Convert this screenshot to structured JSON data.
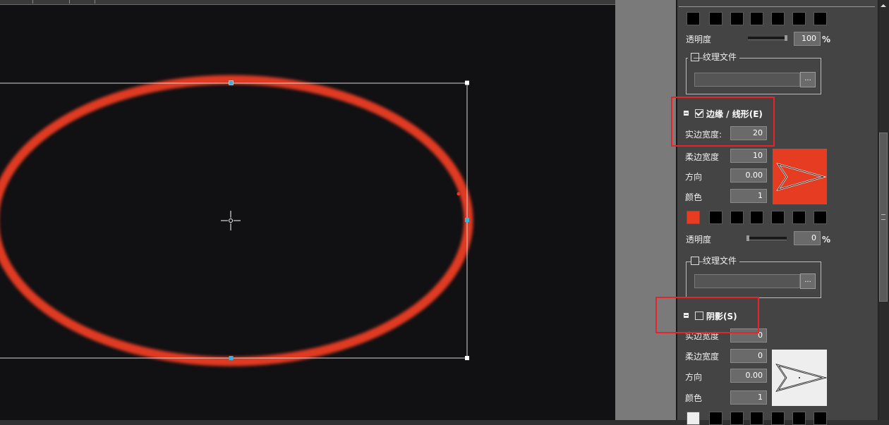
{
  "panel": {
    "opacity_label_1": "透明度",
    "opacity_value_1": "100",
    "opacity_unit_1": "%",
    "texture_file_label_1": "纹理文件",
    "edge_section": {
      "title": "边缘 / 线形(E)",
      "checked": true,
      "solid_width_label": "实边宽度:",
      "solid_width_value": "20",
      "soft_width_label": "柔边宽度",
      "soft_width_value": "10",
      "direction_label": "方向",
      "direction_value": "0.00",
      "color_label": "颜色",
      "color_value": "1",
      "preview_color": "#e63d22"
    },
    "opacity_label_2": "透明度",
    "opacity_value_2": "0",
    "opacity_unit_2": "%",
    "texture_file_label_2": "纹理文件",
    "shadow_section": {
      "title": "阴影(S)",
      "checked": false,
      "solid_width_label": "实边宽度",
      "solid_width_value": "0",
      "soft_width_label": "柔边宽度",
      "soft_width_value": "0",
      "direction_label": "方向",
      "direction_value": "0.00",
      "color_label": "颜色",
      "color_value": "1",
      "preview_color": "#eeeeee"
    },
    "browse_label": "...",
    "highlight_color": "#e8242a"
  },
  "canvas": {
    "background": "#111013",
    "ellipse_color": "#e03a22"
  }
}
